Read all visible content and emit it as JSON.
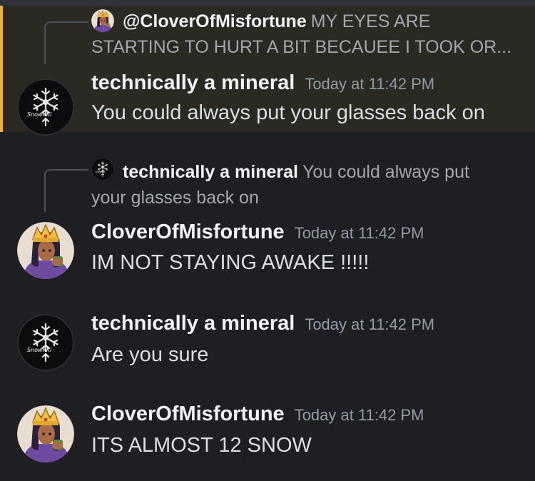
{
  "messages": [
    {
      "reply": {
        "author": "@CloverOfMisfortune",
        "text": "MY EYES ARE STARTING TO HURT A BIT BECAUEE I TOOK OR..."
      },
      "author": "technically a mineral",
      "timestamp": "Today at 11:42 PM",
      "content": "You could always put your glasses back on",
      "avatar_label": "SnowKKi"
    },
    {
      "reply": {
        "author": "technically a mineral",
        "text": "You could always put your glasses back on"
      },
      "author": "CloverOfMisfortune",
      "timestamp": "Today at 11:42 PM",
      "content": "IM NOT STAYING AWAKE !!!!!"
    },
    {
      "author": "technically a mineral",
      "timestamp": "Today at 11:42 PM",
      "content": "Are you sure",
      "avatar_label": "SnowKKi"
    },
    {
      "author": "CloverOfMisfortune",
      "timestamp": "Today at 11:42 PM",
      "content": "ITS ALMOST 12 SNOW"
    }
  ],
  "colors": {
    "background": "#1e1f22",
    "mention_highlight": "#2a2922",
    "mention_bar": "#f0b132",
    "author": "#f2f3f5",
    "timestamp": "#949ba4",
    "text": "#dbdee1"
  },
  "icons": {
    "snowflake_avatar": "snowflake-avatar-icon",
    "crowned_character_avatar": "crowned-character-avatar-icon"
  }
}
